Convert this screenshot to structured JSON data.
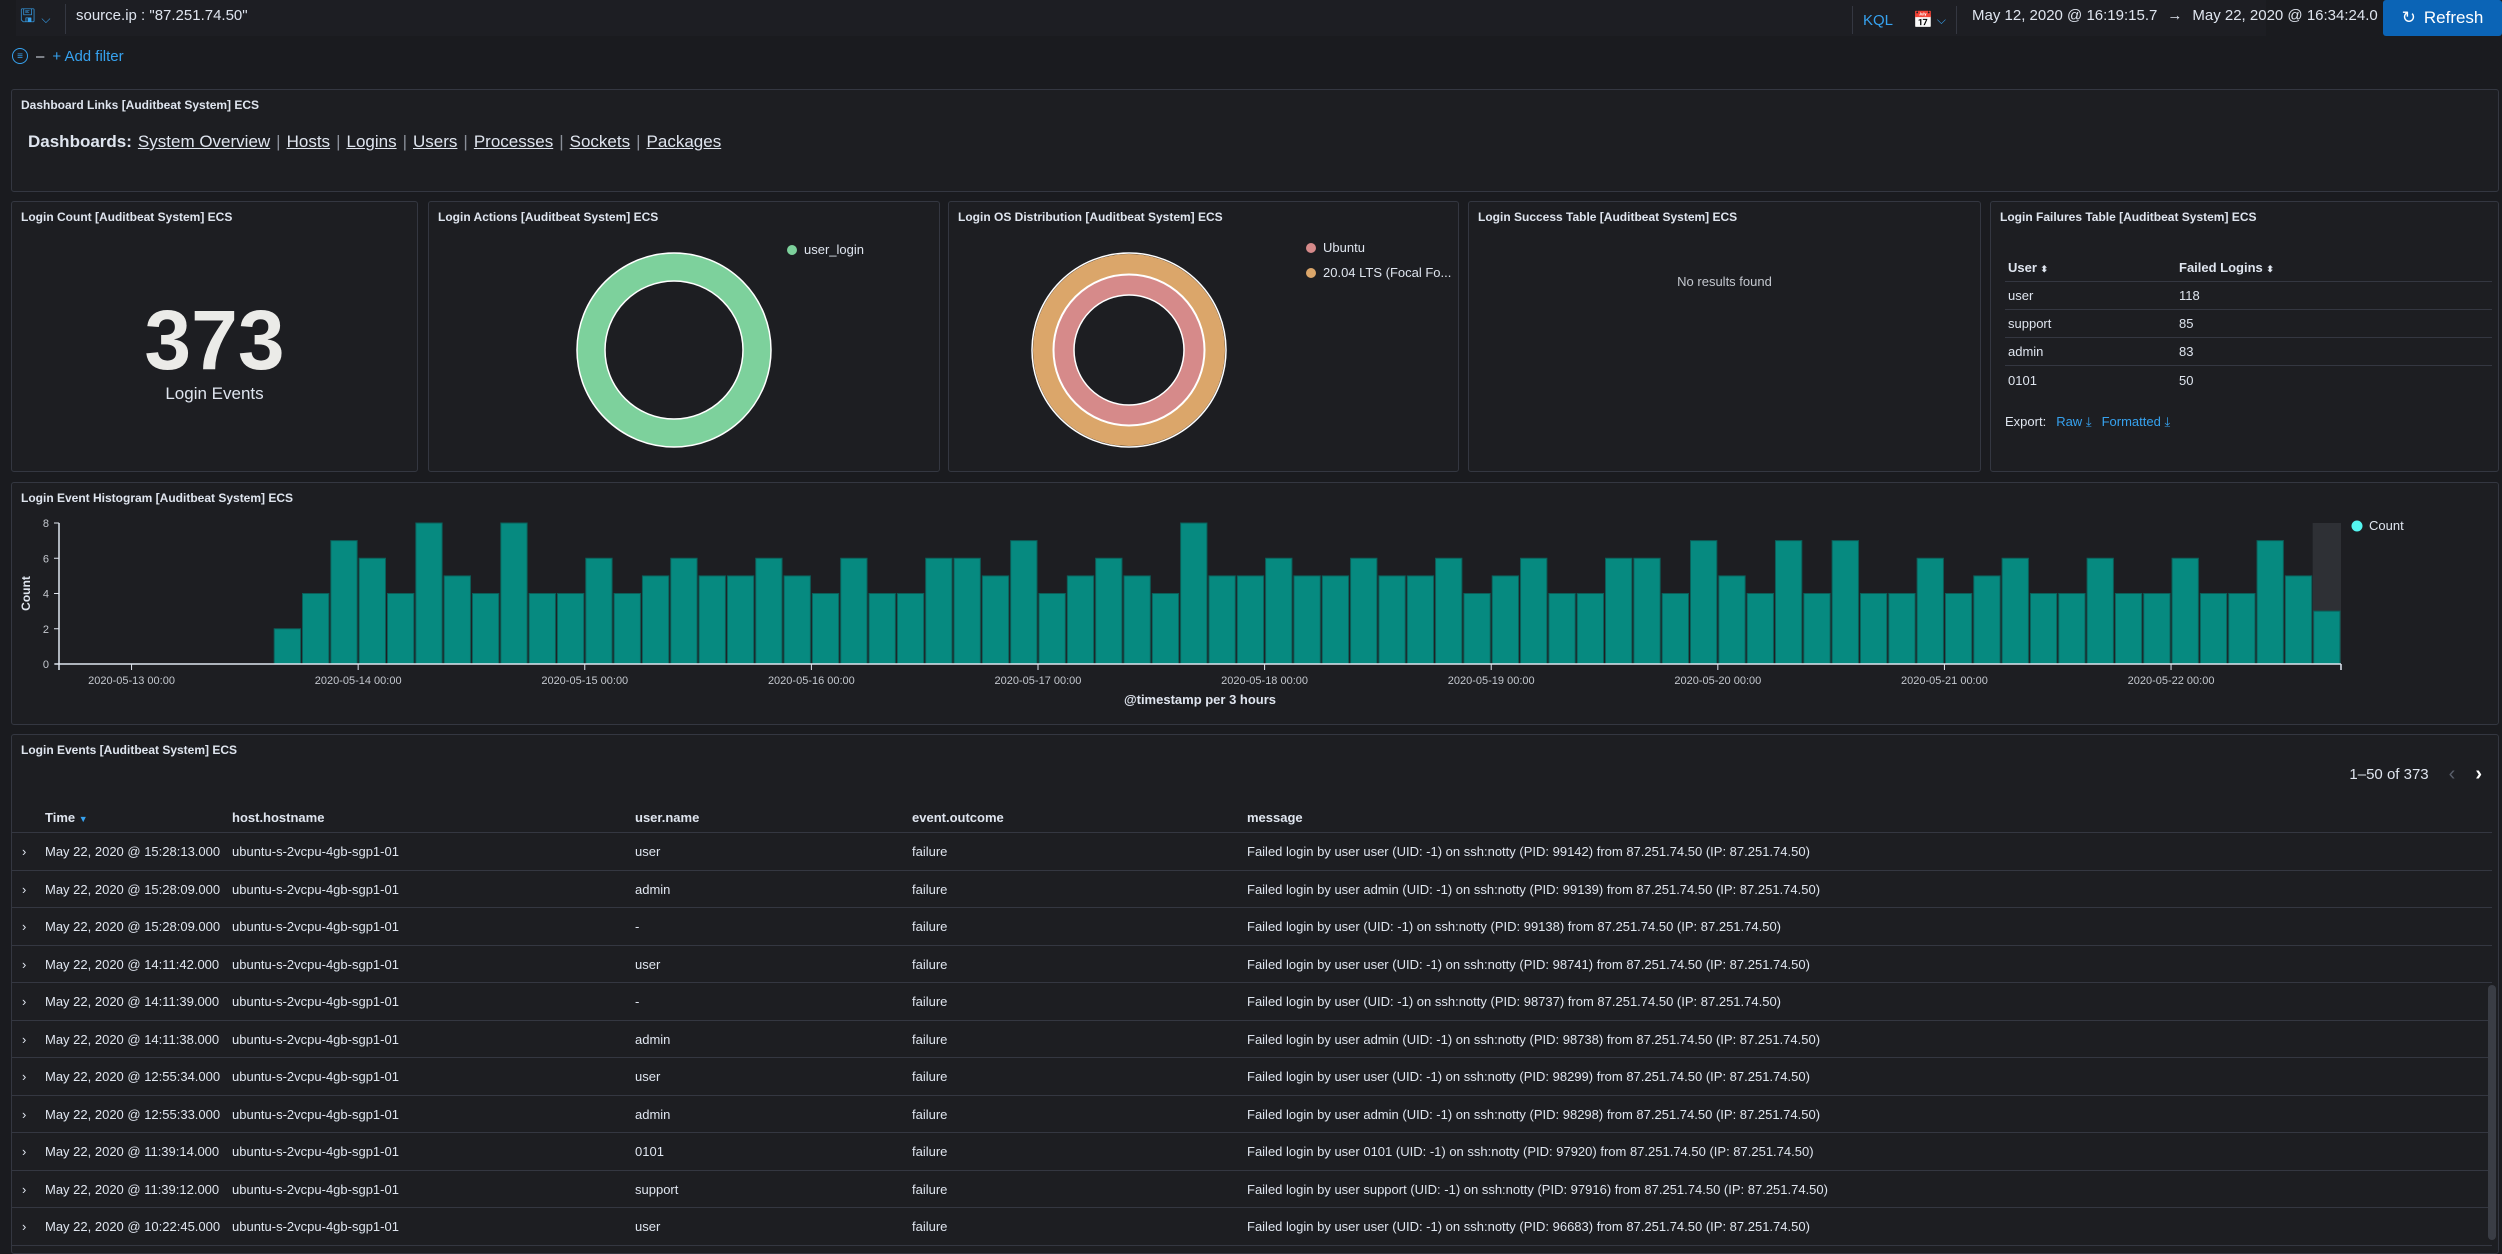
{
  "query_bar": {
    "query": "source.ip : \"87.251.74.50\"",
    "language": "KQL",
    "start": "May 12, 2020 @ 16:19:15.7",
    "arrow": "→",
    "end": "May 22, 2020 @ 16:34:24.0",
    "refresh_label": "Refresh",
    "add_filter": "+ Add filter"
  },
  "dashboard_links": {
    "title": "Dashboard Links [Auditbeat System] ECS",
    "prefix": "Dashboards:",
    "links": [
      "System Overview",
      "Hosts",
      "Logins",
      "Users",
      "Processes",
      "Sockets",
      "Packages"
    ]
  },
  "login_count": {
    "title": "Login Count [Auditbeat System] ECS",
    "value": "373",
    "label": "Login Events"
  },
  "login_actions": {
    "title": "Login Actions [Auditbeat System] ECS",
    "legend": [
      "user_login"
    ],
    "colors": [
      "#7dd19c"
    ]
  },
  "login_os": {
    "title": "Login OS Distribution [Auditbeat System] ECS",
    "legend": [
      "Ubuntu",
      "20.04 LTS (Focal Fo..."
    ],
    "colors": [
      "#d68a8a",
      "#dba66a"
    ]
  },
  "login_success": {
    "title": "Login Success Table [Auditbeat System] ECS",
    "empty": "No results found"
  },
  "login_failures": {
    "title": "Login Failures Table [Auditbeat System] ECS",
    "headers": [
      "User",
      "Failed Logins"
    ],
    "rows": [
      [
        "user",
        "118"
      ],
      [
        "support",
        "85"
      ],
      [
        "admin",
        "83"
      ],
      [
        "0101",
        "50"
      ]
    ],
    "export_label": "Export:",
    "raw": "Raw",
    "formatted": "Formatted"
  },
  "histogram": {
    "title": "Login Event Histogram [Auditbeat System] ECS"
  },
  "chart_data": {
    "type": "bar",
    "title": "",
    "xlabel": "@timestamp per 3 hours",
    "ylabel": "Count",
    "legend": [
      "Count"
    ],
    "legend_placement": "right",
    "color": "#068a80",
    "legend_color": "#54f5f0",
    "ylim": [
      0,
      8
    ],
    "yticks": [
      "0",
      "2",
      "4",
      "6",
      "8"
    ],
    "xlim": [
      "2020-05-12 16:19",
      "2020-05-22 18:00"
    ],
    "xticks": [
      "2020-05-13 00:00",
      "2020-05-14 00:00",
      "2020-05-15 00:00",
      "2020-05-16 00:00",
      "2020-05-17 00:00",
      "2020-05-18 00:00",
      "2020-05-19 00:00",
      "2020-05-20 00:00",
      "2020-05-21 00:00",
      "2020-05-22 00:00"
    ],
    "first_bucket": "2020-05-13 15:00",
    "bucket_hours": 3,
    "values": [
      2,
      4,
      7,
      6,
      4,
      8,
      5,
      4,
      8,
      4,
      4,
      6,
      4,
      5,
      6,
      5,
      5,
      6,
      5,
      4,
      6,
      4,
      4,
      6,
      6,
      5,
      7,
      4,
      5,
      6,
      5,
      4,
      8,
      5,
      5,
      6,
      5,
      5,
      6,
      5,
      5,
      6,
      4,
      5,
      6,
      4,
      4,
      6,
      6,
      4,
      7,
      5,
      4,
      7,
      4,
      7,
      4,
      4,
      6,
      4,
      5,
      6,
      4,
      4,
      6,
      4,
      4,
      6,
      4,
      4,
      7,
      5,
      3
    ]
  },
  "events": {
    "title": "Login Events [Auditbeat System] ECS",
    "pager": "1–50 of 373",
    "headers": [
      "Time",
      "host.hostname",
      "user.name",
      "event.outcome",
      "message"
    ],
    "rows": [
      [
        "May 22, 2020 @ 15:28:13.000",
        "ubuntu-s-2vcpu-4gb-sgp1-01",
        "user",
        "failure",
        "Failed login by user user (UID: -1) on ssh:notty (PID: 99142) from 87.251.74.50 (IP: 87.251.74.50)"
      ],
      [
        "May 22, 2020 @ 15:28:09.000",
        "ubuntu-s-2vcpu-4gb-sgp1-01",
        "admin",
        "failure",
        "Failed login by user admin (UID: -1) on ssh:notty (PID: 99139) from 87.251.74.50 (IP: 87.251.74.50)"
      ],
      [
        "May 22, 2020 @ 15:28:09.000",
        "ubuntu-s-2vcpu-4gb-sgp1-01",
        " -",
        "failure",
        "Failed login by user  (UID: -1) on ssh:notty (PID: 99138) from 87.251.74.50 (IP: 87.251.74.50)"
      ],
      [
        "May 22, 2020 @ 14:11:42.000",
        "ubuntu-s-2vcpu-4gb-sgp1-01",
        "user",
        "failure",
        "Failed login by user user (UID: -1) on ssh:notty (PID: 98741) from 87.251.74.50 (IP: 87.251.74.50)"
      ],
      [
        "May 22, 2020 @ 14:11:39.000",
        "ubuntu-s-2vcpu-4gb-sgp1-01",
        " -",
        "failure",
        "Failed login by user  (UID: -1) on ssh:notty (PID: 98737) from 87.251.74.50 (IP: 87.251.74.50)"
      ],
      [
        "May 22, 2020 @ 14:11:38.000",
        "ubuntu-s-2vcpu-4gb-sgp1-01",
        "admin",
        "failure",
        "Failed login by user admin (UID: -1) on ssh:notty (PID: 98738) from 87.251.74.50 (IP: 87.251.74.50)"
      ],
      [
        "May 22, 2020 @ 12:55:34.000",
        "ubuntu-s-2vcpu-4gb-sgp1-01",
        "user",
        "failure",
        "Failed login by user user (UID: -1) on ssh:notty (PID: 98299) from 87.251.74.50 (IP: 87.251.74.50)"
      ],
      [
        "May 22, 2020 @ 12:55:33.000",
        "ubuntu-s-2vcpu-4gb-sgp1-01",
        "admin",
        "failure",
        "Failed login by user admin (UID: -1) on ssh:notty (PID: 98298) from 87.251.74.50 (IP: 87.251.74.50)"
      ],
      [
        "May 22, 2020 @ 11:39:14.000",
        "ubuntu-s-2vcpu-4gb-sgp1-01",
        "0101",
        "failure",
        "Failed login by user 0101 (UID: -1) on ssh:notty (PID: 97920) from 87.251.74.50 (IP: 87.251.74.50)"
      ],
      [
        "May 22, 2020 @ 11:39:12.000",
        "ubuntu-s-2vcpu-4gb-sgp1-01",
        "support",
        "failure",
        "Failed login by user support (UID: -1) on ssh:notty (PID: 97916) from 87.251.74.50 (IP: 87.251.74.50)"
      ],
      [
        "May 22, 2020 @ 10:22:45.000",
        "ubuntu-s-2vcpu-4gb-sgp1-01",
        "user",
        "failure",
        "Failed login by user user (UID: -1) on ssh:notty (PID: 96683) from 87.251.74.50 (IP: 87.251.74.50)"
      ]
    ]
  }
}
